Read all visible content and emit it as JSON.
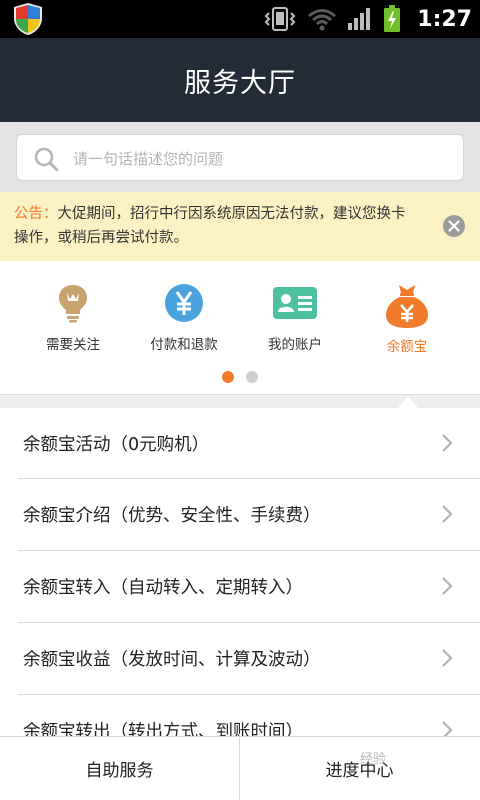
{
  "status_bar": {
    "time": "1:27",
    "icons": [
      "shield-icon",
      "vibrate-icon",
      "wifi-icon",
      "signal-icon",
      "battery-charging-icon"
    ]
  },
  "header": {
    "title": "服务大厅"
  },
  "search": {
    "placeholder": "请一句话描述您的问题"
  },
  "notice": {
    "label": "公告：",
    "text": "大促期间，招行中行因系统原因无法付款，建议您换卡操作，或稍后再尝试付款。"
  },
  "categories": [
    {
      "label": "需要关注",
      "icon": "lightbulb-icon",
      "active": false
    },
    {
      "label": "付款和退款",
      "icon": "yen-coin-icon",
      "active": false
    },
    {
      "label": "我的账户",
      "icon": "id-card-icon",
      "active": false
    },
    {
      "label": "余额宝",
      "icon": "money-bag-icon",
      "active": true
    }
  ],
  "pager": {
    "current": 1,
    "total": 2
  },
  "list_items": [
    {
      "label": "余额宝活动（0元购机）"
    },
    {
      "label": "余额宝介绍（优势、安全性、手续费）"
    },
    {
      "label": "余额宝转入（自动转入、定期转入）"
    },
    {
      "label": "余额宝收益（发放时间、计算及波动）"
    },
    {
      "label": "余额宝转出（转出方式、到账时间）"
    }
  ],
  "bottom_tabs": [
    {
      "label": "自助服务"
    },
    {
      "label": "进度中心"
    }
  ],
  "watermark": "经验",
  "colors": {
    "accent": "#f07b2a",
    "header_bg": "#232b36",
    "notice_bg": "#fcf0c5"
  }
}
